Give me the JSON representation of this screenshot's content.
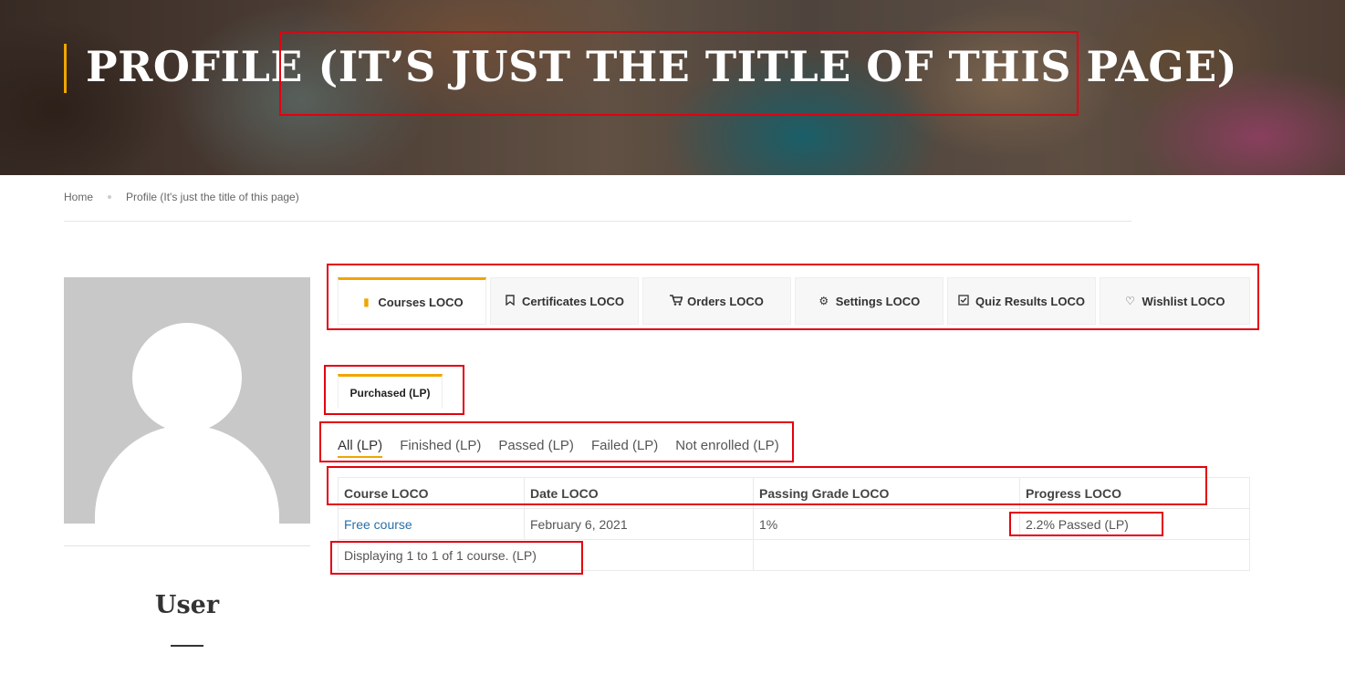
{
  "hero": {
    "title_main": "PROFILE",
    "title_suffix": "(IT’S JUST THE TITLE OF THIS PAGE)",
    "accent_color": "#f0a500"
  },
  "breadcrumb": {
    "home": "Home",
    "current": "Profile (It's just the title of this page)"
  },
  "sidebar": {
    "user_name": "User",
    "avatar_icon": "user-placeholder-icon"
  },
  "tabs": [
    {
      "label": "Courses LOCO",
      "icon": "book-icon",
      "active": true
    },
    {
      "label": "Certificates LOCO",
      "icon": "bookmark-icon",
      "active": false
    },
    {
      "label": "Orders LOCO",
      "icon": "cart-icon",
      "active": false
    },
    {
      "label": "Settings LOCO",
      "icon": "gear-icon",
      "active": false
    },
    {
      "label": "Quiz Results LOCO",
      "icon": "check-square-icon",
      "active": false
    },
    {
      "label": "Wishlist LOCO",
      "icon": "heart-icon",
      "active": false
    }
  ],
  "subtab": {
    "label": "Purchased (LP)"
  },
  "filters": [
    {
      "label": "All (LP)",
      "active": true
    },
    {
      "label": "Finished (LP)",
      "active": false
    },
    {
      "label": "Passed (LP)",
      "active": false
    },
    {
      "label": "Failed (LP)",
      "active": false
    },
    {
      "label": "Not enrolled (LP)",
      "active": false
    }
  ],
  "table": {
    "headers": [
      "Course LOCO",
      "Date LOCO",
      "Passing Grade LOCO",
      "Progress LOCO"
    ],
    "rows": [
      {
        "course": "Free course",
        "date": "February 6, 2021",
        "passing_grade": "1%",
        "progress": "2.2% Passed (LP)"
      }
    ],
    "footer": "Displaying 1 to 1 of 1 course. (LP)"
  },
  "colors": {
    "annotation_red": "#e3000f",
    "link_blue": "#2a6fa8"
  }
}
